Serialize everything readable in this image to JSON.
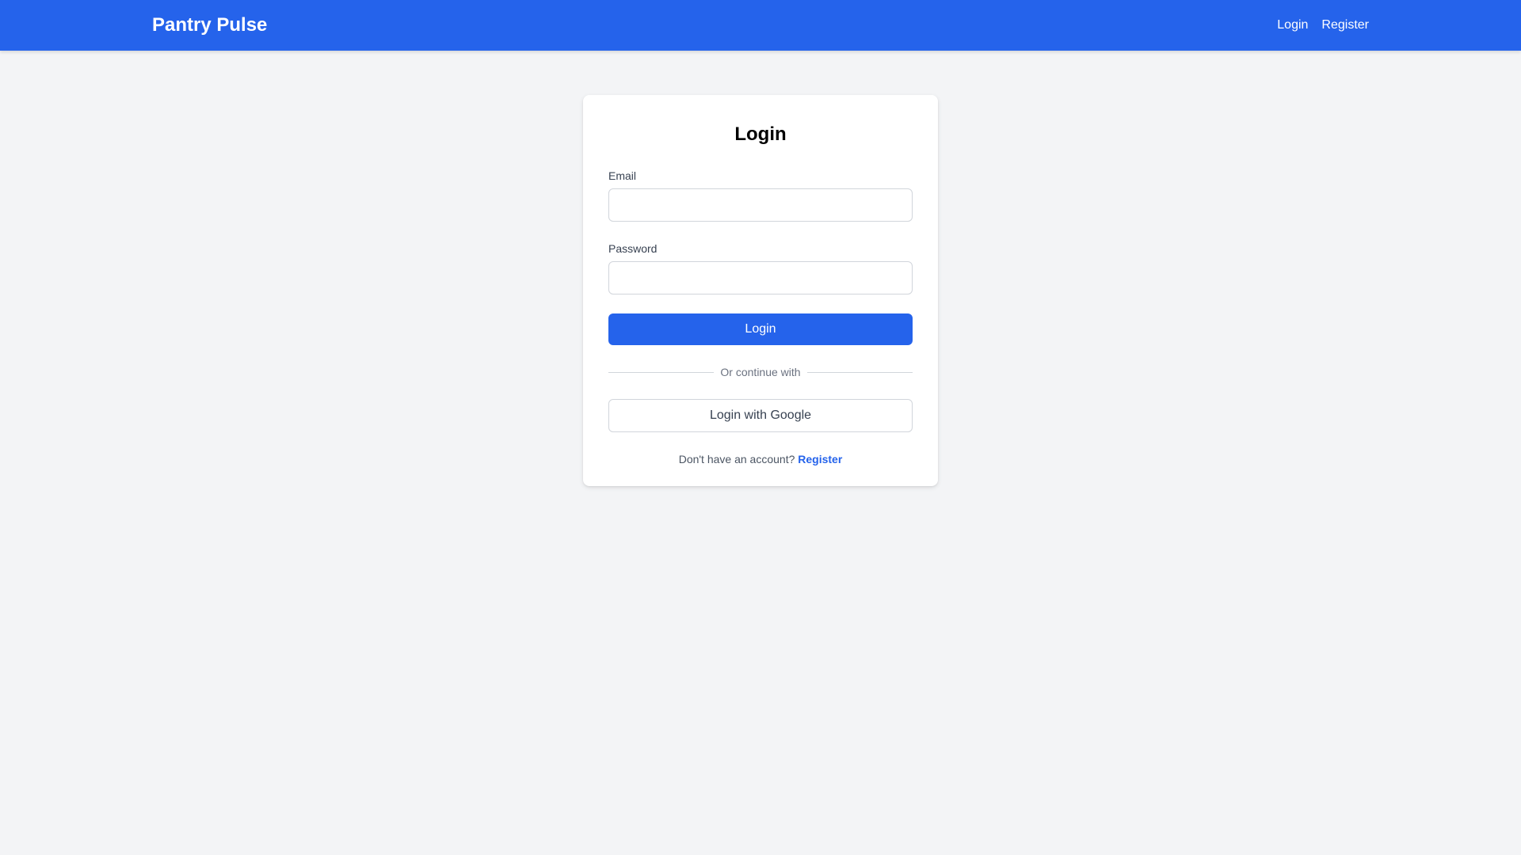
{
  "navbar": {
    "brand": "Pantry Pulse",
    "links": [
      {
        "label": "Login"
      },
      {
        "label": "Register"
      }
    ]
  },
  "login_form": {
    "title": "Login",
    "email_label": "Email",
    "email_value": "",
    "password_label": "Password",
    "password_value": "",
    "submit_label": "Login",
    "divider_text": "Or continue with",
    "google_label": "Login with Google",
    "footer_prompt": "Don't have an account?",
    "footer_link": "Register"
  },
  "colors": {
    "primary": "#2563eb",
    "background": "#f3f4f6",
    "card": "#ffffff"
  }
}
